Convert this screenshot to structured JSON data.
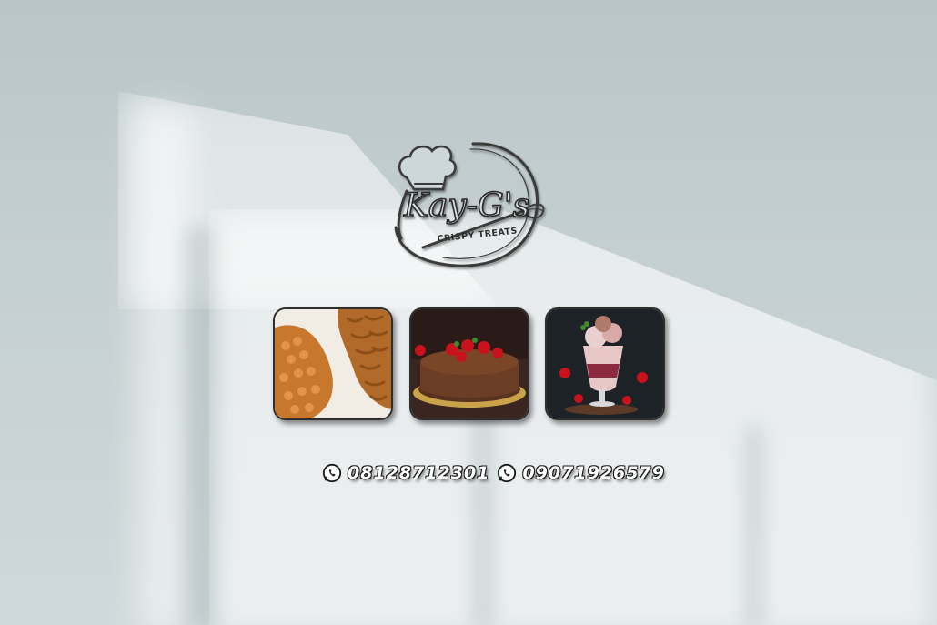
{
  "logo": {
    "brand_name": "Kay-G's",
    "tagline": "CRISPY TREATS",
    "icon": "chef-hat-whisk-logo"
  },
  "gallery": [
    {
      "name": "chin-chin-snacks",
      "icon": "snacks-photo"
    },
    {
      "name": "chocolate-strawberry-cake",
      "icon": "cake-photo"
    },
    {
      "name": "strawberry-ice-cream-sundae",
      "icon": "sundae-photo"
    }
  ],
  "contacts": [
    {
      "icon": "whatsapp-icon",
      "number": "08128712301"
    },
    {
      "icon": "whatsapp-icon",
      "number": "09071926579"
    }
  ],
  "colors": {
    "wall": "#c4cfd1",
    "logo_stroke": "#3a3a3a",
    "number_fill": "#ffffff",
    "number_outline": "#1a1a1a"
  }
}
